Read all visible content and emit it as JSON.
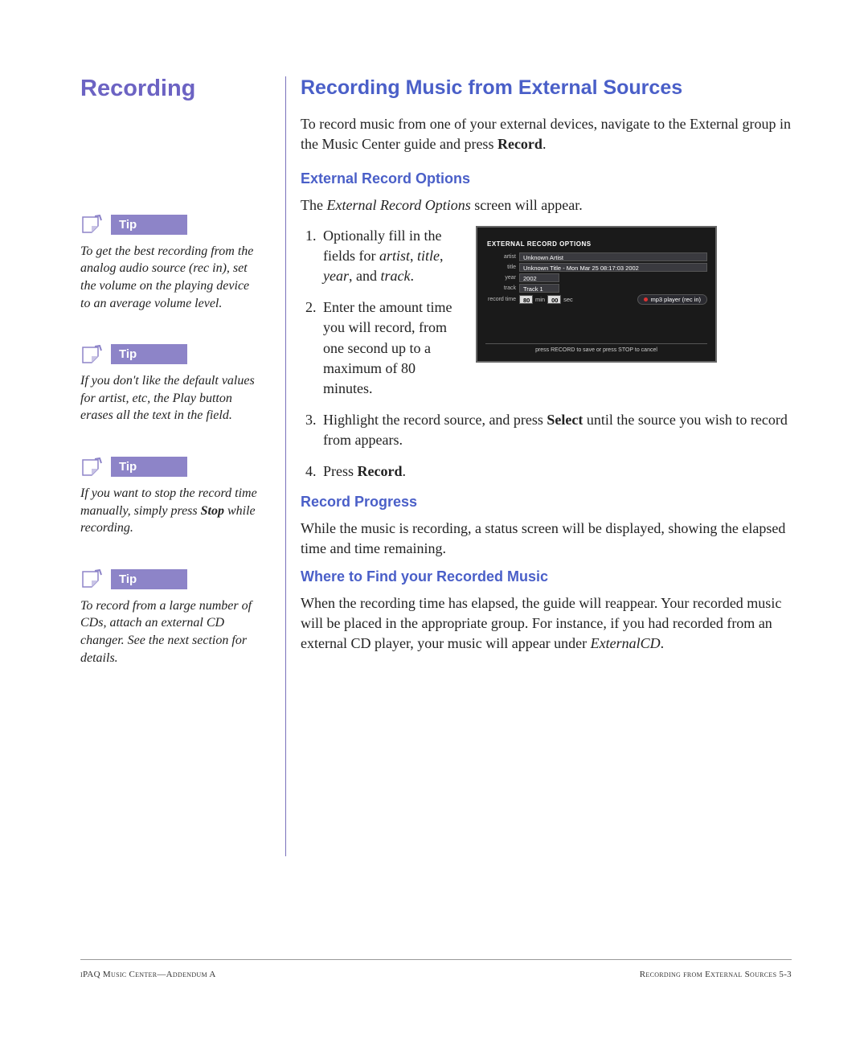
{
  "left": {
    "section_title": "Recording",
    "tip_label": "Tip",
    "tips": [
      {
        "text": "To get the best recording from the analog audio source (rec in), set the volume on the playing device to an average volume level."
      },
      {
        "text": "If you don't like the default values for artist, etc, the Play button erases all the text in the field."
      },
      {
        "text_pre": "If you want to stop the record time manually, simply press ",
        "bold": "Stop",
        "text_post": " while recording."
      },
      {
        "text": "To record from a large number of CDs, attach an external CD changer. See the next section for details."
      }
    ]
  },
  "right": {
    "h1": "Recording Music from External Sources",
    "intro_pre": "To record music from one of your external devices, navigate to the External group in the Music Center guide and press ",
    "intro_bold": "Record",
    "intro_post": ".",
    "h2a": "External Record Options",
    "p2_pre": "The ",
    "p2_ital": "External Record Options",
    "p2_post": " screen will appear.",
    "step1_pre": "Optionally fill in the fields for ",
    "step1_i1": "artist",
    "step1_c1": ", ",
    "step1_i2": "title",
    "step1_c2": ", ",
    "step1_i3": "year",
    "step1_c3": ", and ",
    "step1_i4": "track",
    "step1_end": ".",
    "step2": "Enter the amount time you will record, from one second up to a maximum of 80 minutes.",
    "step3_pre": "Highlight the record source, and press ",
    "step3_bold": "Select",
    "step3_post": " until the source you wish to record from appears.",
    "step4_pre": "Press ",
    "step4_bold": "Record",
    "step4_post": ".",
    "h2b": "Record Progress",
    "p3": "While the music is recording, a status screen will be displayed, showing the elapsed time and time remaining.",
    "h2c": "Where to Find your Recorded Music",
    "p4_pre": "When the recording time has elapsed, the guide will reappear. Your recorded music will be placed in the appropriate group. For instance, if you had recorded from an external CD player, your music will appear under ",
    "p4_ital": "ExternalCD",
    "p4_post": "."
  },
  "screenshot": {
    "title": "EXTERNAL RECORD OPTIONS",
    "rows": {
      "artist_label": "artist",
      "artist_value": "Unknown Artist",
      "title_label": "title",
      "title_value": "Unknown Title - Mon Mar 25 08:17:03 2002",
      "year_label": "year",
      "year_value": "2002",
      "track_label": "track",
      "track_value": "Track 1",
      "recordtime_label": "record time",
      "min_value": "80",
      "min_unit": "min",
      "sec_value": "00",
      "sec_unit": "sec",
      "source": "mp3 player (rec in)"
    },
    "footer": "press RECORD to save or press STOP to cancel"
  },
  "footer": {
    "left": "iPAQ Music Center—Addendum A",
    "right": "Recording from External Sources  5-3"
  }
}
